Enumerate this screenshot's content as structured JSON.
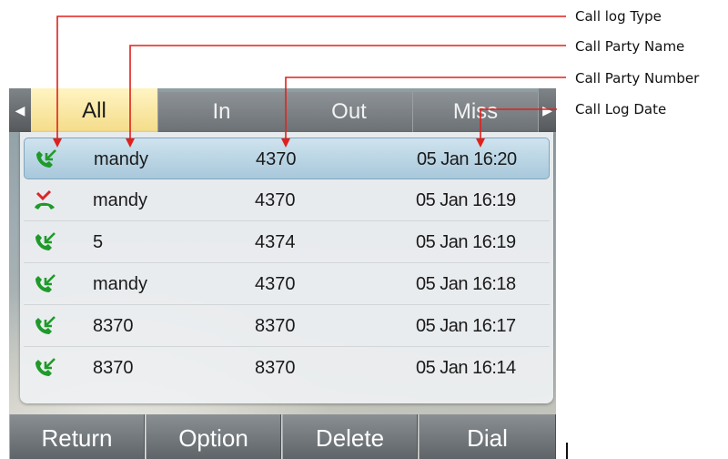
{
  "tabs": [
    {
      "label": "All",
      "active": true
    },
    {
      "label": "In",
      "active": false
    },
    {
      "label": "Out",
      "active": false
    },
    {
      "label": "Miss",
      "active": false
    }
  ],
  "calls": [
    {
      "type": "incoming-received",
      "name": "mandy",
      "number": "4370",
      "date": "05 Jan 16:20",
      "selected": true
    },
    {
      "type": "missed",
      "name": "mandy",
      "number": "4370",
      "date": "05 Jan 16:19",
      "selected": false
    },
    {
      "type": "incoming-received",
      "name": "5",
      "number": "4374",
      "date": "05 Jan 16:19",
      "selected": false
    },
    {
      "type": "incoming-received",
      "name": "mandy",
      "number": "4370",
      "date": "05 Jan 16:18",
      "selected": false
    },
    {
      "type": "incoming-received",
      "name": "8370",
      "number": "8370",
      "date": "05 Jan 16:17",
      "selected": false
    },
    {
      "type": "incoming-received",
      "name": "8370",
      "number": "8370",
      "date": "05 Jan 16:14",
      "selected": false
    }
  ],
  "softkeys": [
    "Return",
    "Option",
    "Delete",
    "Dial"
  ],
  "annotations": [
    {
      "label": "Call log Type"
    },
    {
      "label": "Call Party Name"
    },
    {
      "label": "Call Party Number"
    },
    {
      "label": "Call Log Date"
    }
  ],
  "colors": {
    "annotation_line": "#e0201b",
    "received_icon": "#1f9a2a",
    "missed_icon": "#d8262a",
    "active_tab": "#f4dc8a",
    "selected_row": "#a8c8db"
  },
  "icons": {
    "tab_left": "caret-left-icon",
    "tab_right": "caret-right-icon",
    "received": "phone-incoming-icon",
    "missed": "phone-missed-icon"
  }
}
